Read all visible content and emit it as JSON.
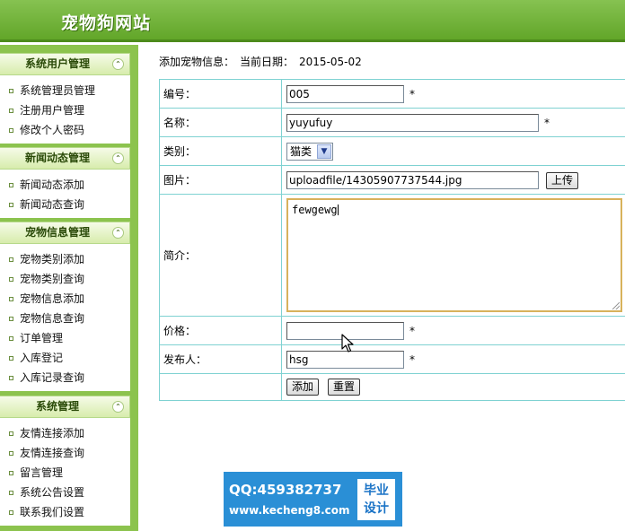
{
  "header": {
    "title": "宠物狗网站"
  },
  "sidebar": {
    "groups": [
      {
        "title": "系统用户管理",
        "items": [
          "系统管理员管理",
          "注册用户管理",
          "修改个人密码"
        ]
      },
      {
        "title": "新闻动态管理",
        "items": [
          "新闻动态添加",
          "新闻动态查询"
        ]
      },
      {
        "title": "宠物信息管理",
        "items": [
          "宠物类别添加",
          "宠物类别查询",
          "宠物信息添加",
          "宠物信息查询",
          "订单管理",
          "入库登记",
          "入库记录查询"
        ]
      },
      {
        "title": "系统管理",
        "items": [
          "友情连接添加",
          "友情连接查询",
          "留言管理",
          "系统公告设置",
          "联系我们设置"
        ]
      }
    ],
    "collapse_glyph": "⌃"
  },
  "main": {
    "heading": "添加宠物信息：",
    "date_label": "当前日期：",
    "date_value": "2015-05-02"
  },
  "form": {
    "id_label": "编号：",
    "id_value": "005",
    "name_label": "名称：",
    "name_value": "yuyufuy",
    "category_label": "类别：",
    "category_value": "猫类",
    "image_label": "图片：",
    "image_value": "uploadfile/14305907737544.jpg",
    "upload_button": "上传",
    "intro_label": "简介：",
    "intro_value": "fewgewg",
    "price_label": "价格：",
    "price_value": "",
    "publisher_label": "发布人：",
    "publisher_value": "hsg",
    "required_mark": "*",
    "submit_button": "添加",
    "reset_button": "重置"
  },
  "watermark": {
    "qq": "QQ:459382737",
    "url": "www.kecheng8.com",
    "badge_line1": "毕业",
    "badge_line2": "设计"
  },
  "colors": {
    "header_green": "#62a629",
    "sidebar_green": "#8cc34e",
    "table_border": "#7fd2d2",
    "watermark_blue": "#2a8fd6"
  }
}
